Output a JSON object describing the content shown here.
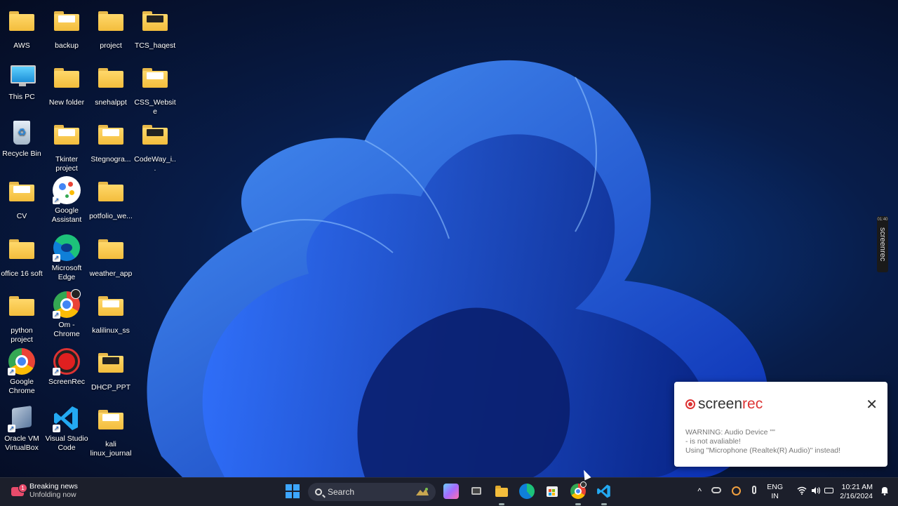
{
  "desktop": {
    "icons": [
      {
        "label": "AWS"
      },
      {
        "label": "backup"
      },
      {
        "label": "project"
      },
      {
        "label": "TCS_haqest"
      },
      {
        "label": "This PC"
      },
      {
        "label": "New folder"
      },
      {
        "label": "snehalppt"
      },
      {
        "label": "CSS_Website"
      },
      {
        "label": "Recycle Bin"
      },
      {
        "label": "Tkinter project"
      },
      {
        "label": "Stegnogra..."
      },
      {
        "label": "CodeWay_i..."
      },
      {
        "label": "CV"
      },
      {
        "label": "Google Assistant"
      },
      {
        "label": "potfolio_we..."
      },
      {
        "label": "office 16 soft"
      },
      {
        "label": "Microsoft Edge"
      },
      {
        "label": "weather_app"
      },
      {
        "label": "python project"
      },
      {
        "label": "Om - Chrome"
      },
      {
        "label": "kalilinux_ss"
      },
      {
        "label": "Google Chrome"
      },
      {
        "label": "ScreenRec"
      },
      {
        "label": "DHCP_PPT"
      },
      {
        "label": "Oracle VM VirtualBox"
      },
      {
        "label": "Visual Studio Code"
      },
      {
        "label": "kali linux_journal"
      }
    ]
  },
  "side_tab": {
    "label": "screenrec",
    "time": "01:40"
  },
  "notification": {
    "brand_a": "screen",
    "brand_b": "rec",
    "line1": "WARNING: Audio Device \"\"",
    "line2": "- is not avaliable!",
    "line3": "Using \"Microphone (Realtek(R) Audio)\" instead!",
    "close": "✕"
  },
  "taskbar": {
    "news_title": "Breaking news",
    "news_sub": "Unfolding now",
    "news_badge": "1",
    "search_placeholder": "Search",
    "tray_chevron": "^",
    "lang1": "ENG",
    "lang2": "IN",
    "time": "10:21 AM",
    "date": "2/16/2024"
  },
  "colors": {
    "accent": "#3da6ff",
    "screenrec_red": "#d33333",
    "taskbar_bg": "#1c1f2b"
  }
}
